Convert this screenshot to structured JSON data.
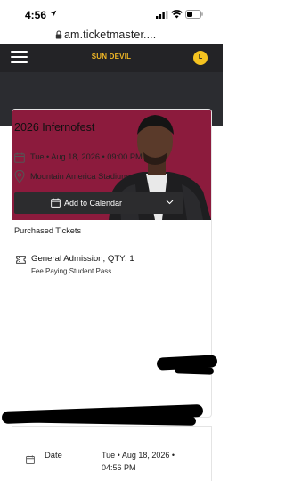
{
  "status_bar": {
    "time": "4:56"
  },
  "browser": {
    "url": "am.ticketmaster...."
  },
  "header": {
    "brand": "SUN DEVIL",
    "avatar_initial": "L"
  },
  "event": {
    "title": "2026 Infernofest",
    "datetime": "Tue • Aug 18, 2026 • 09:00 PM",
    "venue": "Mountain America Stadium",
    "add_to_calendar": "Add to Calendar",
    "hero_color": "#8c1b3d"
  },
  "tickets": {
    "heading": "Purchased Tickets",
    "item_title": "General Admission, QTY: 1",
    "item_subtitle": "Fee Paying Student Pass"
  },
  "details": {
    "date_label": "Date",
    "date_value_line1": "Tue • Aug 18, 2026 •",
    "date_value_line2": "04:56 PM"
  },
  "icons": [
    "location-arrow-icon",
    "signal-icon",
    "wifi-icon",
    "battery-icon",
    "lock-icon",
    "menu-icon",
    "calendar-icon",
    "map-pin-icon",
    "chevron-down-icon",
    "ticket-icon"
  ],
  "colors": {
    "appbar": "#232326",
    "brand": "#f2b825",
    "button": "#2c2c2e"
  }
}
